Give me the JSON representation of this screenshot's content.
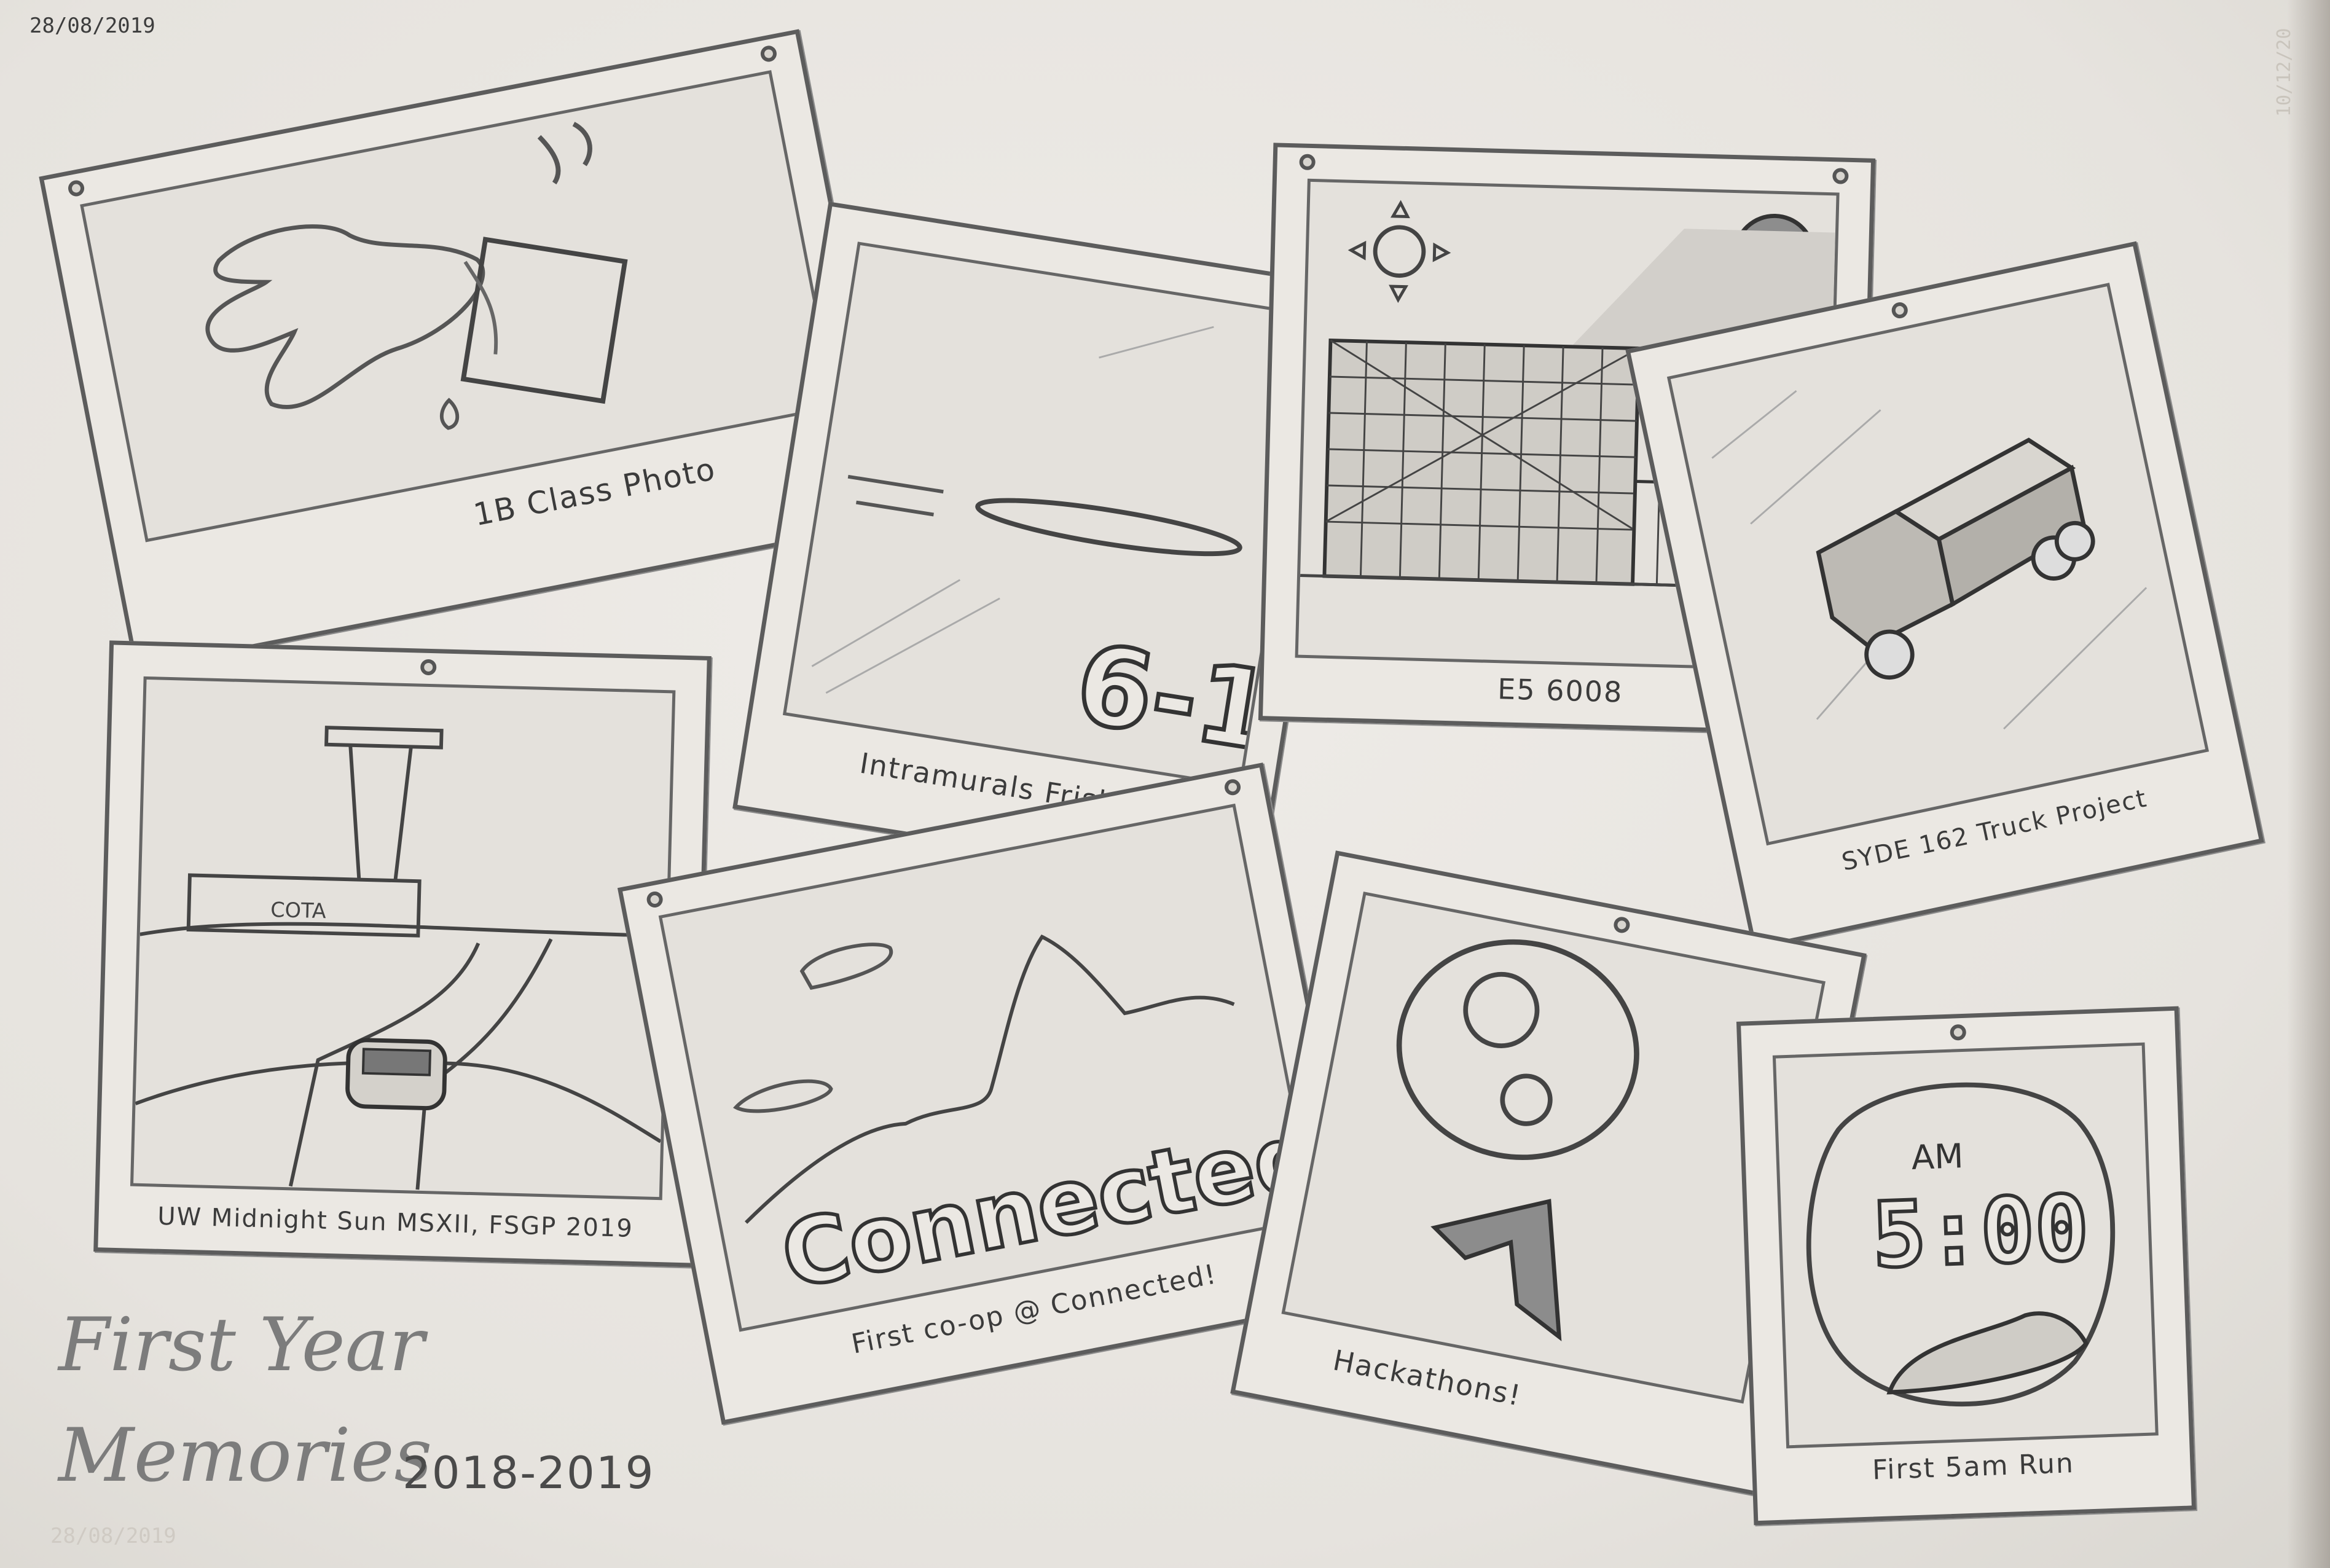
{
  "sketch_date": "28/08/2019",
  "sketch_date_ghost": "28/08/2019",
  "side_date_ghost": "10/12/20",
  "heading": {
    "line1": "First Year",
    "line2": "Memories",
    "years": "2018-2019"
  },
  "photos": [
    {
      "caption": "1B Class Photo",
      "scene": "spilled-cup"
    },
    {
      "caption": "Intramurals Frisbee",
      "scene": "frisbee",
      "score": "6-1"
    },
    {
      "caption": "E5 6008",
      "scene": "engineering-building"
    },
    {
      "caption": "SYDE 162 Truck Project",
      "scene": "truck"
    },
    {
      "caption": "UW Midnight Sun MSXII, FSGP 2019",
      "scene": "race-track",
      "sign": "COTA"
    },
    {
      "caption": "First co-op @ Connected!",
      "scene": "mountains",
      "logo_text": "Connected"
    },
    {
      "caption": "Hackathons!",
      "scene": "gears"
    },
    {
      "caption": "First 5am Run",
      "scene": "alarm-clock",
      "clock_period": "AM",
      "clock_time": "5:00"
    }
  ]
}
